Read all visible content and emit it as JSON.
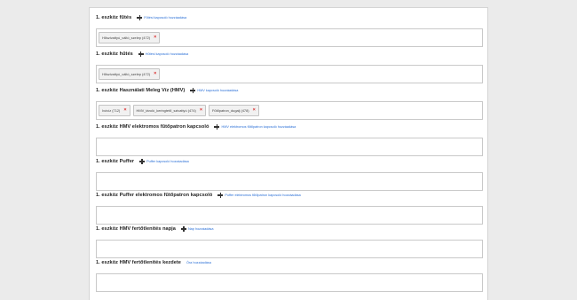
{
  "sections": [
    {
      "title": "1. eszköz fűtés",
      "add_label": "Fűtési kapcsoló hozzáadása",
      "chips": [
        "Hőszivattyú_váltó_szelep (472)"
      ]
    },
    {
      "title": "1. eszköz hűtés",
      "add_label": "Hűtési kapcsoló hozzáadása",
      "chips": [
        "Hőszivattyú_váltó_szelep (472)"
      ]
    },
    {
      "title": "1. eszköz Használati Meleg Víz (HMV)",
      "add_label": "HMV kapcsoló hozzáadása",
      "chips": [
        "Ivóvíz (712)",
        "HMV_tároló_keringtető_szivattyú (474)",
        "Fűtőpatron_dugalj (478)"
      ]
    },
    {
      "title": "1. eszköz HMV elektromos fűtőpatron kapcsoló",
      "add_label": "HMV elektromos fűtőpatron kapcsoló hozzáadása",
      "chips": []
    },
    {
      "title": "1. eszköz Puffer",
      "add_label": "Puffer kapcsoló hozzáadása",
      "chips": []
    },
    {
      "title": "1. eszköz Puffer elektromos fűtőpatron kapcsoló",
      "add_label": "Puffer elektromos fűtőpatron kapcsoló hozzáadása",
      "chips": []
    },
    {
      "title": "1. eszköz HMV fertőtlenítés napja",
      "add_label": "Nap hozzáadása",
      "chips": []
    },
    {
      "title": "1. eszköz HMV fertőtlenítés kezdete",
      "add_label": "Óra hozzáadása",
      "chips": []
    }
  ],
  "icons": {
    "add": "plus-icon",
    "remove": "close-icon"
  },
  "colors": {
    "link": "#2a6fd6",
    "remove": "#d92b2b"
  }
}
